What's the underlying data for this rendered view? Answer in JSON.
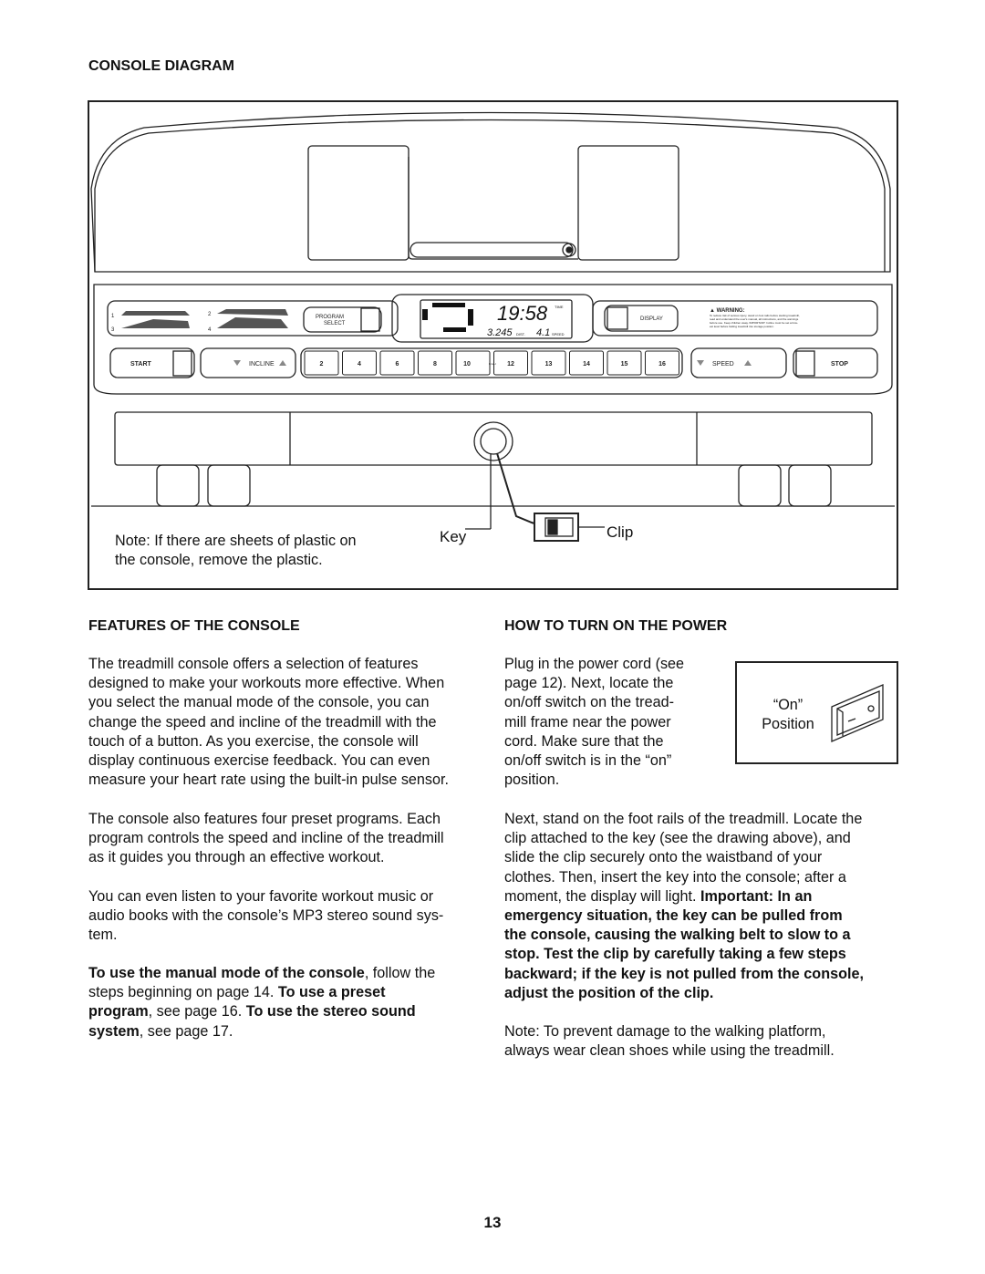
{
  "console_diagram": {
    "heading": "CONSOLE DIAGRAM",
    "note": [
      "Note: If there are sheets of plastic on",
      "the console, remove the plastic."
    ],
    "key_label": "Key",
    "clip_label": "Clip",
    "panel": {
      "program_button": [
        "PROGRAM",
        "SELECT"
      ],
      "profile_numbers": [
        "1",
        "2",
        "3",
        "4"
      ],
      "display_time": "19:58",
      "time_label": "TIME",
      "display_distance": "3.245",
      "distance_label": "DIST.",
      "display_speed": "4.1",
      "speed_label": "SPEED",
      "display_button": "DISPLAY",
      "warning_title": "▲ WARNING:",
      "warning_text": [
        "To reduce risk of serious injury, stand on foot rails before starting treadmill,",
        "read and understand the user's manual, all instructions, and the warnings",
        "before use. Keep children away. IMPORTANT: Incline must be set at low-",
        "est level before folding treadmill into storage position."
      ],
      "start": "START",
      "incline": "INCLINE",
      "speed": "SPEED",
      "stop": "STOP",
      "kmh": "Km/H",
      "speed_keys": [
        "2",
        "4",
        "6",
        "8",
        "10",
        "12",
        "13",
        "14",
        "15",
        "16"
      ]
    }
  },
  "features": {
    "heading": "FEATURES OF THE CONSOLE",
    "p1": [
      "The treadmill console offers a selection of features",
      "designed to make your workouts more effective. When",
      "you select the manual mode of the console, you can",
      "change the speed and incline of the treadmill with the",
      "touch of a button. As you exercise, the console will",
      "display continuous exercise feedback. You can even",
      "measure your heart rate using the built-in pulse sensor."
    ],
    "p2": [
      "The console also features four preset programs. Each",
      "program controls the speed and incline of the treadmill",
      "as it guides you through an effective workout."
    ],
    "p3": [
      "You can even listen to your favorite workout music or",
      "audio books with the console’s MP3 stereo sound sys-",
      "tem."
    ],
    "p4": {
      "b1": "To use the manual mode of the console",
      "t1": ", follow the",
      "t2": "steps beginning on page 14. ",
      "b2": "To use a preset",
      "b3": "program",
      "t3": ", see page 16. ",
      "b4": "To use the stereo sound",
      "b5": "system",
      "t4": ", see page 17."
    }
  },
  "power": {
    "heading": "HOW TO TURN ON THE POWER",
    "p1": [
      "Plug in the power cord (see",
      "page 12). Next, locate the",
      "on/off switch on the tread-",
      "mill frame near the power",
      "cord. Make sure that the",
      "on/off switch is in the “on”",
      "position."
    ],
    "on_label": [
      "“On”",
      "Position"
    ],
    "p2": [
      "Next, stand on the foot rails of the treadmill. Locate the",
      "clip attached to the key (see the drawing above), and",
      "slide the clip securely onto the waistband of your",
      "clothes. Then, insert the key into the console; after a"
    ],
    "p2_last": "moment, the display will light. ",
    "p2_bold": [
      "Important: In an",
      "emergency situation, the key can be pulled from",
      "the console, causing the walking belt to slow to a",
      "stop. Test the clip by carefully taking a few steps",
      "backward; if the key is not pulled from the console,",
      "adjust the position of the clip."
    ],
    "p3": [
      "Note: To prevent damage to the walking platform,",
      "always wear clean shoes while using the treadmill."
    ]
  },
  "page_number": "13"
}
